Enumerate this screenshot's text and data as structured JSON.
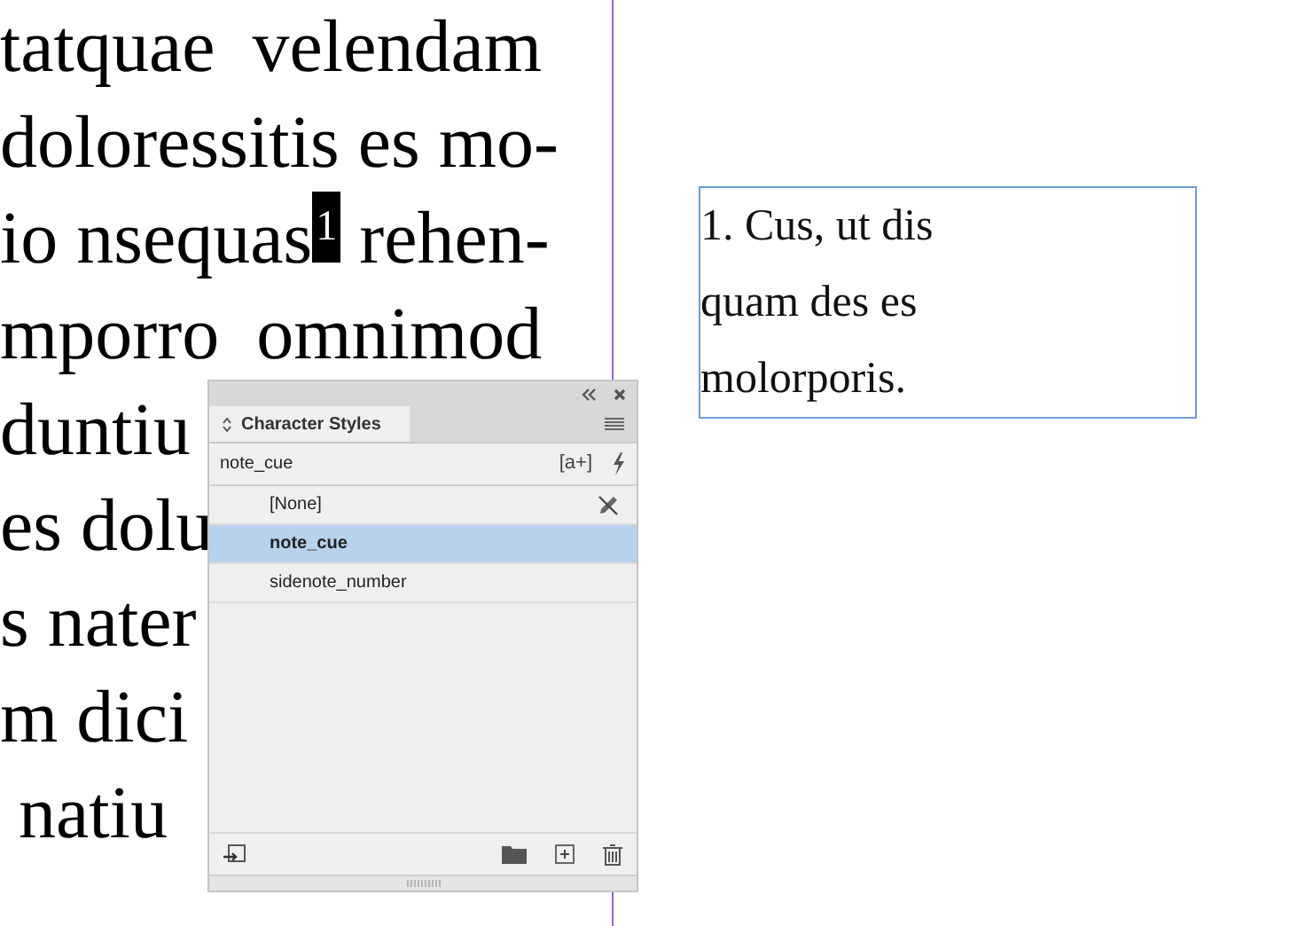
{
  "body_text": {
    "lines": [
      {
        "text": "tatquae  velendam"
      },
      {
        "text": "doloressitis es mo-"
      },
      {
        "text": "io nsequas",
        "cue": {
          "text": "1",
          "selected": true
        },
        "after": " rehen-"
      },
      {
        "text": "mporro  omnimod"
      },
      {
        "text": "duntiu"
      },
      {
        "text": "es dolu"
      },
      {
        "text": "s nater"
      },
      {
        "text": "m dici"
      },
      {
        "text": " natiu"
      }
    ]
  },
  "sidenote": {
    "text": "1.  Cus, ut dis quam des es molorporis."
  },
  "panel": {
    "tab": "Character Styles",
    "current_style": "note_cue",
    "override_button": "[a+]",
    "styles": [
      {
        "name": "[None]",
        "selected": false,
        "locked": true
      },
      {
        "name": "note_cue",
        "selected": true,
        "locked": false
      },
      {
        "name": "sidenote_number",
        "selected": false,
        "locked": false
      }
    ]
  }
}
